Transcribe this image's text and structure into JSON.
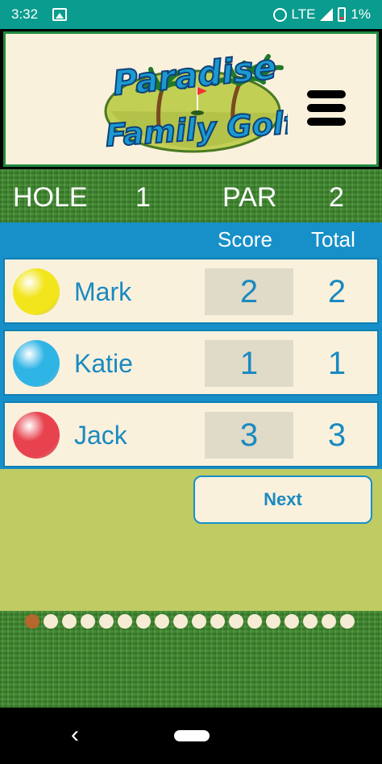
{
  "status_bar": {
    "time": "3:32",
    "network": "LTE",
    "battery": "1%"
  },
  "header": {
    "logo_line1": "Paradise",
    "logo_line2": "Family Golf"
  },
  "hole_bar": {
    "hole_label": "HOLE",
    "hole_number": "1",
    "par_label": "PAR",
    "par_value": "2"
  },
  "score_header": {
    "score_label": "Score",
    "total_label": "Total"
  },
  "players": [
    {
      "name": "Mark",
      "score": "2",
      "total": "2",
      "ball_color": "#f2e51b"
    },
    {
      "name": "Katie",
      "score": "1",
      "total": "1",
      "ball_color": "#2fb4e6"
    },
    {
      "name": "Jack",
      "score": "3",
      "total": "3",
      "ball_color": "#e8424e"
    }
  ],
  "next_button": {
    "label": "Next"
  },
  "hole_progress": {
    "current": 1,
    "total": 18
  },
  "colors": {
    "status_bar": "#0a9c8e",
    "accent_blue": "#1790c9",
    "cream": "#faf1dd",
    "olive": "#bfcb63",
    "active_dot": "#b5672d"
  },
  "icons": [
    "image-icon",
    "alarm-icon",
    "signal-icon",
    "battery-icon",
    "hamburger-menu-icon",
    "back-icon",
    "home-icon"
  ]
}
